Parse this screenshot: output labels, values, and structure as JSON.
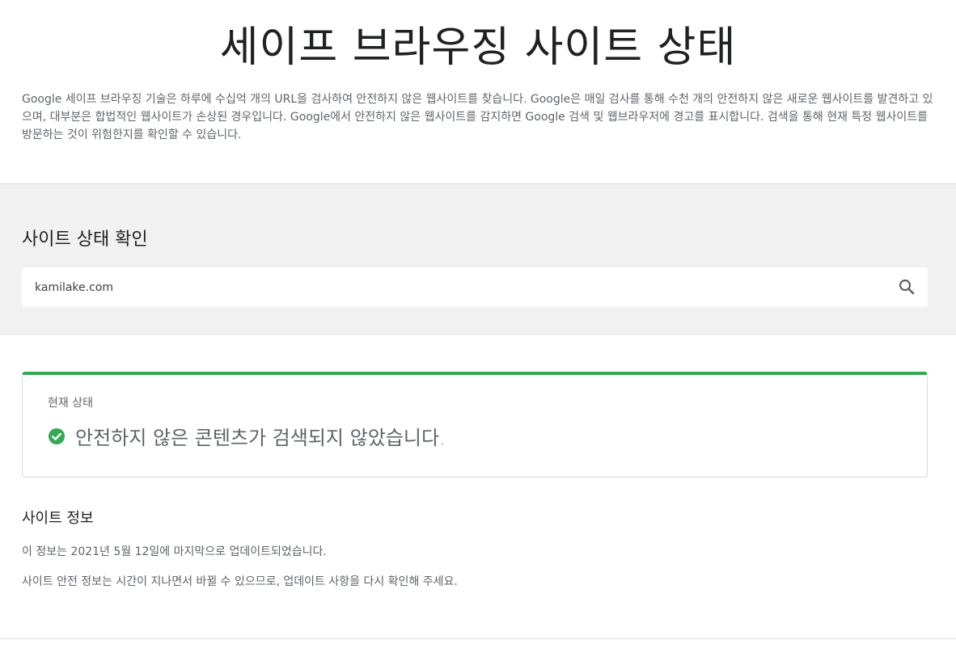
{
  "page": {
    "title": "세이프 브라우징 사이트 상태",
    "intro": "Google 세이프 브라우징 기술은 하루에 수십억 개의 URL을 검사하여 안전하지 않은 웹사이트를 찾습니다. Google은 매일 검사를 통해 수천 개의 안전하지 않은 새로운 웹사이트를 발견하고 있으며, 대부분은 합법적인 웹사이트가 손상된 경우입니다. Google에서 안전하지 않은 웹사이트를 감지하면 Google 검색 및 웹브라우저에 경고를 표시합니다. 검색을 통해 현재 특정 웹사이트를 방문하는 것이 위험한지를 확인할 수 있습니다."
  },
  "search": {
    "heading": "사이트 상태 확인",
    "value": "kamilake.com",
    "placeholder": "",
    "icon": "search-icon"
  },
  "status": {
    "label": "현재 상태",
    "message": "안전하지 않은 콘텐츠가 검색되지 않았습니다.",
    "icon": "check-circle-icon",
    "accent_color": "#34a853"
  },
  "site_info": {
    "heading": "사이트 정보",
    "updated": "이 정보는 2021년 5월 12일에 마지막으로 업데이트되었습니다.",
    "note": "사이트 안전 정보는 시간이 지나면서 바뀔 수 있으므로, 업데이트 사항을 다시 확인해 주세요."
  }
}
